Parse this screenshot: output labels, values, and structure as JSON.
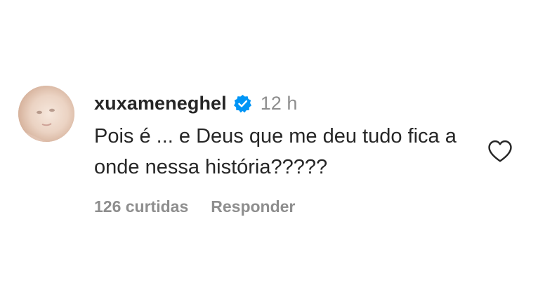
{
  "comment": {
    "username": "xuxameneghel",
    "verified": true,
    "timestamp": "12 h",
    "text": "Pois é ... e Deus que me deu tudo fica a onde nessa história?????",
    "likes_label": "126 curtidas",
    "reply_label": "Responder",
    "like_icon": "heart-outline-icon",
    "verified_icon": "verified-badge-icon"
  },
  "colors": {
    "text_primary": "#262626",
    "text_secondary": "#8e8e8e",
    "verified_blue": "#0095f6",
    "background": "#ffffff"
  }
}
